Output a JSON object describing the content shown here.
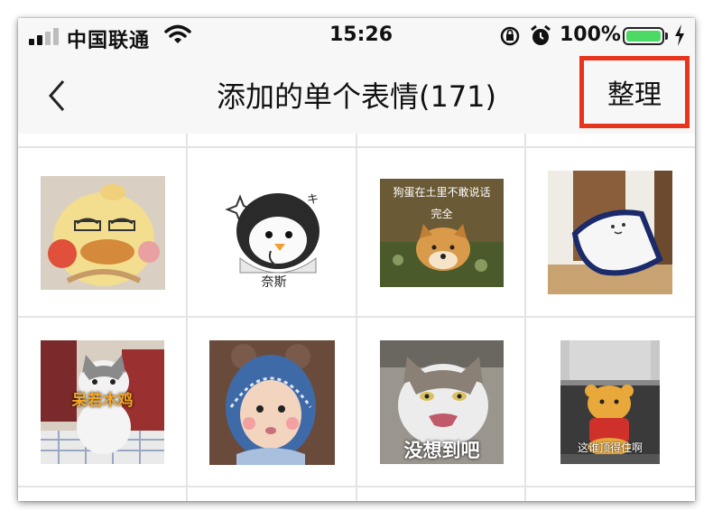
{
  "status_bar": {
    "carrier": "中国联通",
    "time": "15:26",
    "battery_percent": "100%",
    "battery_level": 1.0
  },
  "nav": {
    "title": "添加的单个表情(171)",
    "organize_label": "整理",
    "highlight_color": "#e8341c"
  },
  "stickers": [
    {
      "name": "yellow-bird-sticker"
    },
    {
      "name": "penguin-sticker",
      "caption": "奈斯",
      "mark": "キ"
    },
    {
      "name": "shiba-sticker",
      "caption_top": "狗蛋在土里不敢说话",
      "caption_sub": "完全"
    },
    {
      "name": "sleeping-pillow-sticker"
    },
    {
      "name": "cat-staring-sticker",
      "caption": "呆若木鸡"
    },
    {
      "name": "baby-bonnet-sticker"
    },
    {
      "name": "cat-shocked-sticker",
      "caption": "没想到吧"
    },
    {
      "name": "pooh-press-sticker",
      "caption": "这谁顶得住啊"
    }
  ]
}
